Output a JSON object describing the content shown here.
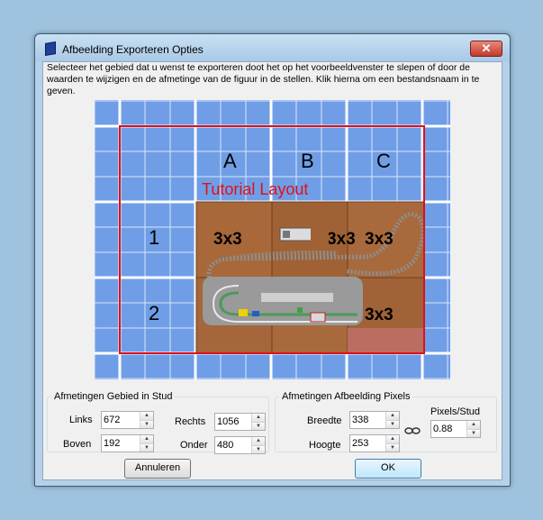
{
  "window": {
    "title": "Afbeelding Exporteren Opties",
    "close_glyph": "✕"
  },
  "intro_text": "Selecteer het gebied dat u wenst te exporteren doot het op het voorbeeldvenster te slepen of door de waarden te wijzigen en de afmetinge van de figuur in de stellen. Klik hierna om een bestandsnaam in te geven.",
  "preview": {
    "columns": [
      "A",
      "B",
      "C"
    ],
    "rows": [
      "1",
      "2"
    ],
    "layout_title": "Tutorial Layout",
    "tile_labels": [
      "3x3",
      "3x3",
      "3x3",
      "3x3"
    ],
    "colors": {
      "grid_bg": "#6f9ee6",
      "grid_line": "#ffffff",
      "selection": "#e0101a",
      "tile": "#a8683a"
    }
  },
  "stud_group": {
    "legend": "Afmetingen Gebied in Stud",
    "links_label": "Links",
    "links_value": "672",
    "boven_label": "Boven",
    "boven_value": "192",
    "rechts_label": "Rechts",
    "rechts_value": "1056",
    "onder_label": "Onder",
    "onder_value": "480"
  },
  "pixel_group": {
    "legend": "Afmetingen Afbeelding Pixels",
    "breedte_label": "Breedte",
    "breedte_value": "338",
    "hoogte_label": "Hoogte",
    "hoogte_value": "253",
    "pixels_per_stud_label": "Pixels/Stud",
    "pixels_per_stud_value": "0.88",
    "link_icon": "chain-link-icon"
  },
  "buttons": {
    "cancel": "Annuleren",
    "ok": "OK"
  }
}
